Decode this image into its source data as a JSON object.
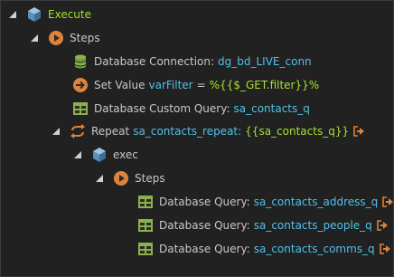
{
  "colors": {
    "background": "#212121",
    "label": "#c8c8c8",
    "root_label": "#a6e22e",
    "value": "#4fc1e9",
    "expression": "#a6e22e",
    "icon_orange": "#e0823a",
    "icon_green": "#8bb24a",
    "icon_blue": "#5a8fb8"
  },
  "tree": {
    "execute": {
      "label": "Execute",
      "icon": "cube-icon"
    },
    "steps": {
      "label": "Steps",
      "icon": "play-circle-icon"
    },
    "db_connection": {
      "label": "Database Connection:",
      "value": "dg_bd_LIVE_conn",
      "icon": "database-icon"
    },
    "set_value": {
      "label": "Set Value",
      "var": "varFilter",
      "eq": "=",
      "expr": "%{{$_GET.filter}}%",
      "icon": "arrow-right-circle-icon"
    },
    "custom_query": {
      "label": "Database Custom Query:",
      "value": "sa_contacts_q",
      "icon": "table-icon"
    },
    "repeat": {
      "label": "Repeat",
      "name": "sa_contacts_repeat:",
      "expr": "{{sa_contacts_q}}",
      "icon": "repeat-icon"
    },
    "exec": {
      "label": "exec",
      "icon": "cube-icon"
    },
    "inner_steps": {
      "label": "Steps",
      "icon": "play-circle-icon"
    },
    "queries": [
      {
        "label": "Database Query:",
        "value": "sa_contacts_address_q",
        "icon": "table-icon"
      },
      {
        "label": "Database Query:",
        "value": "sa_contacts_people_q",
        "icon": "table-icon"
      },
      {
        "label": "Database Query:",
        "value": "sa_contacts_comms_q",
        "icon": "table-icon"
      }
    ]
  }
}
